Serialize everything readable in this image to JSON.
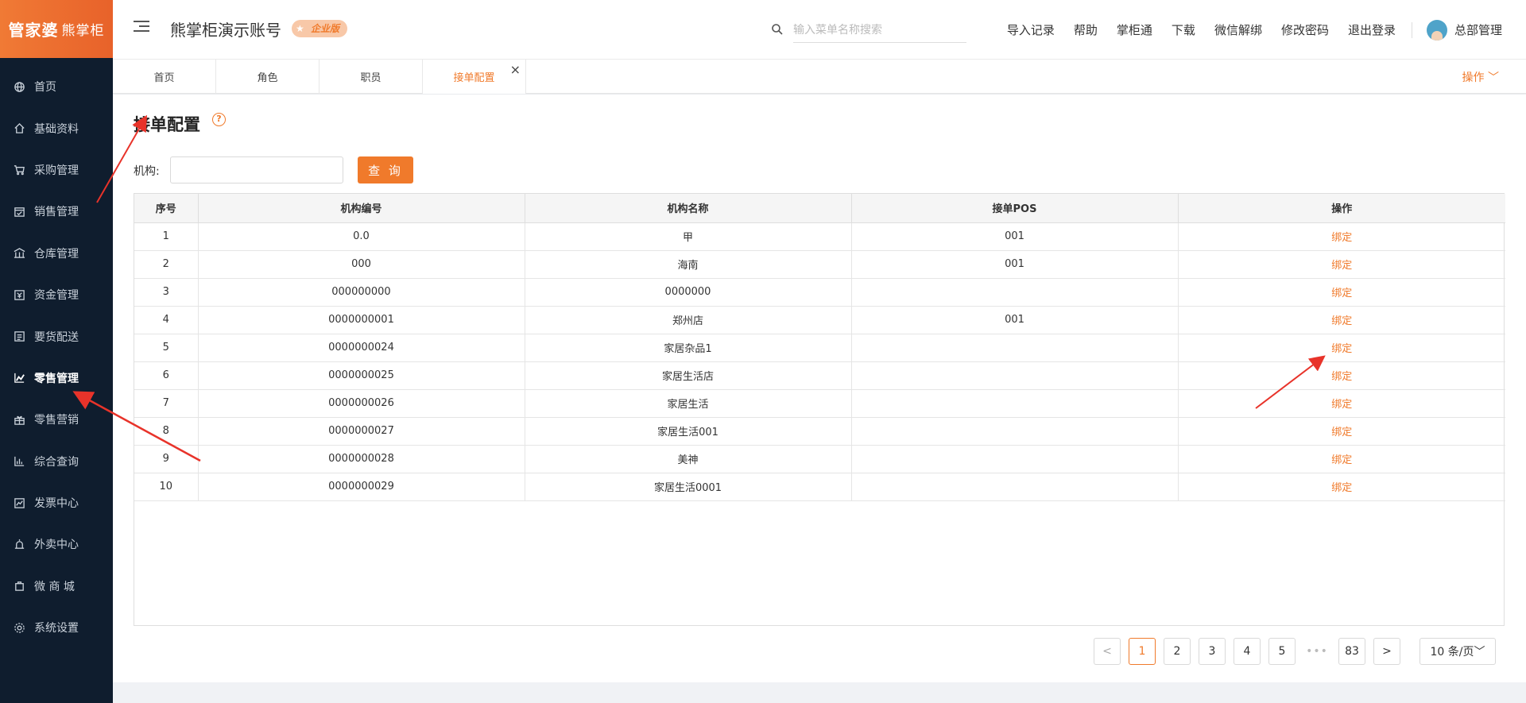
{
  "logo": {
    "main": "管家婆",
    "sub": "熊掌柜"
  },
  "sidebar": {
    "items": [
      {
        "label": "首页",
        "icon": "globe-icon"
      },
      {
        "label": "基础资料",
        "icon": "home-icon"
      },
      {
        "label": "采购管理",
        "icon": "cart-icon"
      },
      {
        "label": "销售管理",
        "icon": "calendar-icon"
      },
      {
        "label": "仓库管理",
        "icon": "warehouse-icon"
      },
      {
        "label": "资金管理",
        "icon": "money-icon"
      },
      {
        "label": "要货配送",
        "icon": "list-icon"
      },
      {
        "label": "零售管理",
        "icon": "chart-icon",
        "active": true
      },
      {
        "label": "零售营销",
        "icon": "gift-icon"
      },
      {
        "label": "综合查询",
        "icon": "bar-chart-icon"
      },
      {
        "label": "发票中心",
        "icon": "trend-icon"
      },
      {
        "label": "外卖中心",
        "icon": "alarm-icon"
      },
      {
        "label": "微 商 城",
        "icon": "bag-icon"
      },
      {
        "label": "系统设置",
        "icon": "gear-icon"
      }
    ]
  },
  "header": {
    "account_title": "熊掌柜演示账号",
    "badge": "企业版",
    "search_placeholder": "输入菜单名称搜索",
    "links": [
      "导入记录",
      "帮助",
      "掌柜通",
      "下载",
      "微信解绑",
      "修改密码",
      "退出登录"
    ],
    "user_name": "总部管理"
  },
  "tabs": {
    "items": [
      {
        "label": "首页"
      },
      {
        "label": "角色"
      },
      {
        "label": "职员"
      },
      {
        "label": "接单配置",
        "active": true
      }
    ],
    "close_symbol": "×",
    "ops_label": "操作 ﹀"
  },
  "page": {
    "title": "接单配置",
    "help_symbol": "?",
    "filter_label": "机构:",
    "query_button": "查 询"
  },
  "table": {
    "columns": [
      "序号",
      "机构编号",
      "机构名称",
      "接单POS",
      "操作"
    ],
    "rows": [
      {
        "no": "1",
        "code": "0.0",
        "name": "甲",
        "pos": "001",
        "op": "绑定"
      },
      {
        "no": "2",
        "code": "000",
        "name": "海南",
        "pos": "001",
        "op": "绑定"
      },
      {
        "no": "3",
        "code": "000000000",
        "name": "0000000",
        "pos": "",
        "op": "绑定"
      },
      {
        "no": "4",
        "code": "0000000001",
        "name": "郑州店",
        "pos": "001",
        "op": "绑定"
      },
      {
        "no": "5",
        "code": "0000000024",
        "name": "家居杂品1",
        "pos": "",
        "op": "绑定"
      },
      {
        "no": "6",
        "code": "0000000025",
        "name": "家居生活店",
        "pos": "",
        "op": "绑定"
      },
      {
        "no": "7",
        "code": "0000000026",
        "name": "家居生活",
        "pos": "",
        "op": "绑定"
      },
      {
        "no": "8",
        "code": "0000000027",
        "name": "家居生活001",
        "pos": "",
        "op": "绑定"
      },
      {
        "no": "9",
        "code": "0000000028",
        "name": "美神",
        "pos": "",
        "op": "绑定"
      },
      {
        "no": "10",
        "code": "0000000029",
        "name": "家居生活0001",
        "pos": "",
        "op": "绑定"
      }
    ]
  },
  "pagination": {
    "prev": "<",
    "pages": [
      "1",
      "2",
      "3",
      "4",
      "5"
    ],
    "dots": "•••",
    "last": "83",
    "next": ">",
    "current": "1",
    "page_size": "10 条/页﹀"
  },
  "colors": {
    "accent": "#f07a2b",
    "sidebar_bg": "#0f1d2e",
    "annotation": "#e8332a"
  }
}
